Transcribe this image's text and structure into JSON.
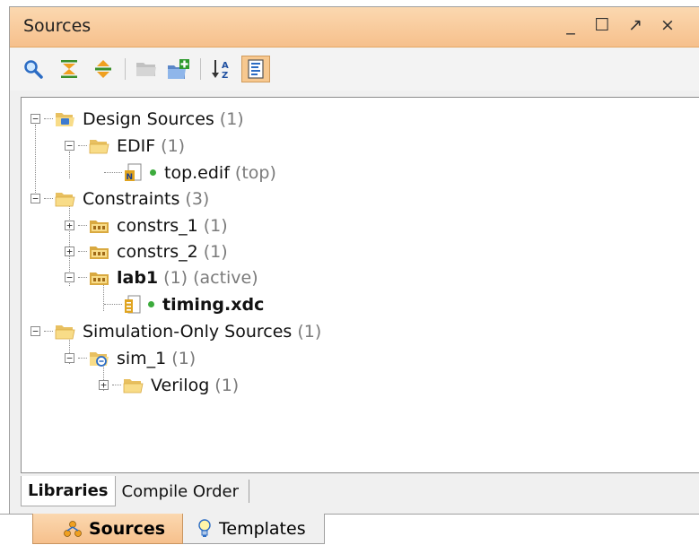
{
  "window": {
    "title": "Sources",
    "controls": {
      "minimize": "_",
      "maximize": "☐",
      "float": "↗",
      "close": "×"
    }
  },
  "toolbar": {
    "items": [
      {
        "icon": "search-icon"
      },
      {
        "icon": "collapse-all-icon"
      },
      {
        "icon": "expand-all-icon"
      },
      {
        "icon": "open-folder-icon"
      },
      {
        "icon": "add-sources-icon"
      },
      {
        "icon": "sort-az-icon"
      },
      {
        "icon": "show-hierarchy-icon",
        "active": true
      }
    ]
  },
  "tree": [
    {
      "label": "Design Sources",
      "count": "(1)",
      "icon": "design-folder-icon",
      "expander": "−"
    },
    {
      "label": "EDIF",
      "count": "(1)",
      "icon": "folder-icon",
      "expander": "−"
    },
    {
      "label": "top.edif",
      "note": "(top)",
      "icon": "netlist-file-icon"
    },
    {
      "label": "Constraints",
      "count": "(3)",
      "icon": "folder-icon",
      "expander": "−"
    },
    {
      "label": "constrs_1",
      "count": "(1)",
      "icon": "constraint-set-icon",
      "expander": "+"
    },
    {
      "label": "constrs_2",
      "count": "(1)",
      "icon": "constraint-set-icon",
      "expander": "+"
    },
    {
      "label": "lab1",
      "count": "(1)",
      "note": "(active)",
      "icon": "constraint-set-icon",
      "expander": "−",
      "bold": true
    },
    {
      "label": "timing.xdc",
      "icon": "xdc-file-icon",
      "bold": true
    },
    {
      "label": "Simulation-Only Sources",
      "count": "(1)",
      "icon": "folder-icon",
      "expander": "−"
    },
    {
      "label": "sim_1",
      "count": "(1)",
      "icon": "simulation-set-icon",
      "expander": "−"
    },
    {
      "label": "Verilog",
      "count": "(1)",
      "icon": "folder-icon",
      "expander": "+"
    }
  ],
  "subtabs": [
    {
      "label": "Libraries",
      "selected": true
    },
    {
      "label": "Compile Order"
    }
  ],
  "bottom_tabs": [
    {
      "label": "Sources",
      "selected": true,
      "icon": "hierarchy-icon"
    },
    {
      "label": "Templates",
      "icon": "lightbulb-icon"
    }
  ],
  "colors": {
    "accent": "#f6c08c",
    "status_dot": "#3cab3c"
  }
}
